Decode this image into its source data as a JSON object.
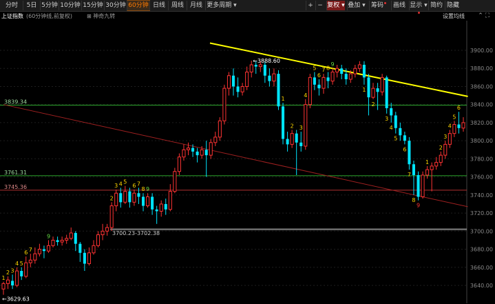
{
  "toolbar": {
    "periods": [
      "分时",
      "5日",
      "5分钟",
      "10分钟",
      "15分钟",
      "30分钟",
      "60分钟",
      "日线",
      "周线",
      "月线",
      "更多周期"
    ],
    "active_period": "60分钟",
    "right_buttons": [
      "+",
      "−",
      "复权",
      "叠加",
      "筹码",
      "画线",
      "显示",
      "简约",
      "隐藏"
    ]
  },
  "subbar": {
    "title": "上证指数",
    "description": "(60分钟线,前复权)",
    "nine_turn": "神奇九转",
    "ma_settings": "设置均线"
  },
  "chart_data": {
    "type": "candlestick",
    "title": "上证指数",
    "ylim": [
      3630,
      3910
    ],
    "y_ticks": [
      3640,
      3660,
      3680,
      3700,
      3720,
      3740,
      3760,
      3780,
      3800,
      3820,
      3840,
      3860,
      3880,
      3900
    ],
    "up_color": "#ff3333",
    "down_color": "#00e5ff",
    "candles": [
      [
        3636,
        3642,
        3629.63,
        3644
      ],
      [
        3642,
        3646,
        3636,
        3650
      ],
      [
        3645,
        3640,
        3636,
        3652
      ],
      [
        3640,
        3656,
        3638,
        3660
      ],
      [
        3656,
        3650,
        3646,
        3660
      ],
      [
        3650,
        3665,
        3648,
        3672
      ],
      [
        3665,
        3668,
        3660,
        3675
      ],
      [
        3668,
        3675,
        3664,
        3682
      ],
      [
        3675,
        3680,
        3672,
        3686
      ],
      [
        3680,
        3678,
        3670,
        3684
      ],
      [
        3678,
        3684,
        3676,
        3690
      ],
      [
        3684,
        3690,
        3682,
        3694
      ],
      [
        3690,
        3688,
        3684,
        3694
      ],
      [
        3688,
        3690,
        3684,
        3694
      ],
      [
        3690,
        3692,
        3686,
        3696
      ],
      [
        3692,
        3698,
        3690,
        3704
      ],
      [
        3698,
        3686,
        3678,
        3700
      ],
      [
        3686,
        3676,
        3666,
        3688
      ],
      [
        3676,
        3664,
        3656,
        3680
      ],
      [
        3664,
        3676,
        3662,
        3682
      ],
      [
        3676,
        3684,
        3674,
        3690
      ],
      [
        3684,
        3696,
        3682,
        3700
      ],
      [
        3696,
        3700,
        3690,
        3708
      ],
      [
        3700,
        3704,
        3695,
        3708
      ],
      [
        3704,
        3728,
        3700.23,
        3732
      ],
      [
        3728,
        3742,
        3722,
        3746
      ],
      [
        3742,
        3732,
        3726,
        3748
      ],
      [
        3732,
        3744,
        3730,
        3750
      ],
      [
        3744,
        3732,
        3726,
        3748
      ],
      [
        3732,
        3742,
        3728,
        3746
      ],
      [
        3742,
        3738,
        3730,
        3748
      ],
      [
        3738,
        3728,
        3722,
        3742
      ],
      [
        3728,
        3738,
        3726,
        3742
      ],
      [
        3738,
        3724,
        3718,
        3742
      ],
      [
        3724,
        3722,
        3708,
        3728
      ],
      [
        3722,
        3730,
        3716,
        3734
      ],
      [
        3730,
        3724,
        3718,
        3736
      ],
      [
        3724,
        3744,
        3722,
        3752
      ],
      [
        3744,
        3766,
        3742,
        3770
      ],
      [
        3766,
        3782,
        3762,
        3786
      ],
      [
        3782,
        3790,
        3778,
        3796
      ],
      [
        3790,
        3792,
        3784,
        3798
      ],
      [
        3792,
        3788,
        3782,
        3796
      ],
      [
        3788,
        3784,
        3776,
        3792
      ],
      [
        3784,
        3790,
        3780,
        3794
      ],
      [
        3790,
        3784,
        3760,
        3800
      ],
      [
        3784,
        3798,
        3780,
        3802
      ],
      [
        3798,
        3804,
        3794,
        3810
      ],
      [
        3804,
        3822,
        3800,
        3826
      ],
      [
        3822,
        3858,
        3818,
        3862
      ],
      [
        3858,
        3872,
        3850,
        3876
      ],
      [
        3872,
        3860,
        3850,
        3880
      ],
      [
        3860,
        3854,
        3848,
        3870
      ],
      [
        3854,
        3860,
        3850,
        3864
      ],
      [
        3860,
        3876,
        3856,
        3882
      ],
      [
        3876,
        3884,
        3870,
        3888.6
      ],
      [
        3884,
        3882,
        3874,
        3888
      ],
      [
        3882,
        3884,
        3876,
        3888
      ],
      [
        3884,
        3872,
        3864,
        3888
      ],
      [
        3872,
        3866,
        3860,
        3880
      ],
      [
        3866,
        3874,
        3860,
        3880
      ],
      [
        3874,
        3838,
        3834,
        3878
      ],
      [
        3838,
        3802,
        3796,
        3842
      ],
      [
        3802,
        3796,
        3788,
        3810
      ],
      [
        3796,
        3808,
        3792,
        3812
      ],
      [
        3808,
        3798,
        3762,
        3812
      ],
      [
        3798,
        3794,
        3788,
        3810
      ],
      [
        3794,
        3840,
        3790,
        3846
      ],
      [
        3840,
        3870,
        3836,
        3874
      ],
      [
        3870,
        3862,
        3856,
        3876
      ],
      [
        3862,
        3858,
        3850,
        3868
      ],
      [
        3858,
        3870,
        3852,
        3874
      ],
      [
        3870,
        3866,
        3858,
        3876
      ],
      [
        3866,
        3876,
        3862,
        3880
      ],
      [
        3876,
        3880,
        3870,
        3884
      ],
      [
        3880,
        3874,
        3868,
        3884
      ],
      [
        3874,
        3868,
        3862,
        3880
      ],
      [
        3868,
        3874,
        3864,
        3878
      ],
      [
        3874,
        3880,
        3870,
        3884
      ],
      [
        3880,
        3884,
        3876,
        3888
      ],
      [
        3884,
        3870,
        3862,
        3888
      ],
      [
        3870,
        3848,
        3828,
        3874
      ],
      [
        3848,
        3858,
        3846,
        3864
      ],
      [
        3858,
        3854,
        3834,
        3864
      ],
      [
        3854,
        3870,
        3850,
        3874
      ],
      [
        3870,
        3836,
        3830,
        3872
      ],
      [
        3836,
        3828,
        3820,
        3842
      ],
      [
        3828,
        3814,
        3808,
        3832
      ],
      [
        3814,
        3806,
        3800,
        3820
      ],
      [
        3806,
        3800,
        3796,
        3810
      ],
      [
        3800,
        3774,
        3768,
        3804
      ],
      [
        3774,
        3762,
        3740,
        3778
      ],
      [
        3762,
        3738,
        3734,
        3766
      ],
      [
        3738,
        3762,
        3736,
        3766
      ],
      [
        3762,
        3768,
        3758,
        3772
      ],
      [
        3768,
        3772,
        3744,
        3776
      ],
      [
        3772,
        3776,
        3768,
        3782
      ],
      [
        3776,
        3784,
        3772,
        3788
      ],
      [
        3784,
        3796,
        3780,
        3800
      ],
      [
        3796,
        3808,
        3792,
        3812
      ],
      [
        3808,
        3818,
        3804,
        3822
      ],
      [
        3818,
        3814,
        3808,
        3832
      ],
      [
        3814,
        3820,
        3810,
        3826
      ]
    ],
    "h_lines": [
      {
        "value": 3839.34,
        "label": "3839.34",
        "color": "#2ea82e"
      },
      {
        "value": 3761.31,
        "label": "3761.31",
        "color": "#2ea82e"
      },
      {
        "value": 3745.36,
        "label": "3745.36",
        "color": "#b03030"
      },
      {
        "value": 3702.38,
        "label": "3700.23-3702.38",
        "color": "#aaaaaa"
      }
    ],
    "annotations": [
      {
        "label": "3888.60",
        "value": 3888.6,
        "index": 55
      },
      {
        "label": "3629.63",
        "value": 3629.63,
        "index": 0
      }
    ],
    "nine_counts": [
      {
        "index": 0,
        "label": "1",
        "color": "#ffd700",
        "pos": "above"
      },
      {
        "index": 1,
        "label": "2",
        "color": "#ffd700",
        "pos": "above"
      },
      {
        "index": 2,
        "label": "3",
        "color": "#ffd700",
        "pos": "above"
      },
      {
        "index": 3,
        "label": "4",
        "color": "#ffd700",
        "pos": "above"
      },
      {
        "index": 4,
        "label": "5",
        "color": "#ffd700",
        "pos": "above"
      },
      {
        "index": 5,
        "label": "6",
        "color": "#ffd700",
        "pos": "above"
      },
      {
        "index": 6,
        "label": "7",
        "color": "#ffd700",
        "pos": "above"
      },
      {
        "index": 10,
        "label": "9",
        "color": "#66dd44",
        "pos": "above"
      },
      {
        "index": 24,
        "label": "2",
        "color": "#ffd700",
        "pos": "above"
      },
      {
        "index": 25,
        "label": "3",
        "color": "#ffd700",
        "pos": "above"
      },
      {
        "index": 26,
        "label": "4",
        "color": "#ffd700",
        "pos": "above"
      },
      {
        "index": 27,
        "label": "5",
        "color": "#ffd700",
        "pos": "above"
      },
      {
        "index": 29,
        "label": "6",
        "color": "#ffd700",
        "pos": "above"
      },
      {
        "index": 30,
        "label": "7",
        "color": "#ffd700",
        "pos": "above"
      },
      {
        "index": 31,
        "label": "8",
        "color": "#ffd700",
        "pos": "above"
      },
      {
        "index": 32,
        "label": "9",
        "color": "#66dd44",
        "pos": "above"
      },
      {
        "index": 62,
        "label": "1",
        "color": "#ffd700",
        "pos": "above"
      },
      {
        "index": 64,
        "label": "2",
        "color": "#ffd700",
        "pos": "above"
      },
      {
        "index": 66,
        "label": "3",
        "color": "#ffd700",
        "pos": "above"
      },
      {
        "index": 67,
        "label": "4",
        "color": "#ffd700",
        "pos": "above"
      },
      {
        "index": 69,
        "label": "5",
        "color": "#ffd700",
        "pos": "above"
      },
      {
        "index": 70,
        "label": "6",
        "color": "#ffd700",
        "pos": "above"
      },
      {
        "index": 71,
        "label": "7",
        "color": "#ffd700",
        "pos": "above"
      },
      {
        "index": 72,
        "label": "8",
        "color": "#ffd700",
        "pos": "above"
      },
      {
        "index": 73,
        "label": "9",
        "color": "#66dd44",
        "pos": "above"
      },
      {
        "index": 80,
        "label": "1",
        "color": "#ffd700",
        "pos": "below"
      },
      {
        "index": 82,
        "label": "2",
        "color": "#ffd700",
        "pos": "below"
      },
      {
        "index": 85,
        "label": "3",
        "color": "#ffd700",
        "pos": "below"
      },
      {
        "index": 86,
        "label": "4",
        "color": "#ffd700",
        "pos": "below"
      },
      {
        "index": 87,
        "label": "5",
        "color": "#ffd700",
        "pos": "below"
      },
      {
        "index": 89,
        "label": "6",
        "color": "#ffd700",
        "pos": "below"
      },
      {
        "index": 90,
        "label": "7",
        "color": "#ffd700",
        "pos": "below"
      },
      {
        "index": 91,
        "label": "8",
        "color": "#ffd700",
        "pos": "below"
      },
      {
        "index": 92,
        "label": "9",
        "color": "#ff3333",
        "pos": "below"
      },
      {
        "index": 94,
        "label": "1",
        "color": "#ffd700",
        "pos": "above"
      },
      {
        "index": 97,
        "label": "2",
        "color": "#ffd700",
        "pos": "above"
      },
      {
        "index": 98,
        "label": "3",
        "color": "#ffd700",
        "pos": "above"
      },
      {
        "index": 99,
        "label": "4",
        "color": "#ffd700",
        "pos": "above"
      },
      {
        "index": 100,
        "label": "5",
        "color": "#ffd700",
        "pos": "above"
      },
      {
        "index": 101,
        "label": "6",
        "color": "#ffd700",
        "pos": "above"
      }
    ],
    "trendlines": [
      {
        "color": "#ffff00",
        "start": {
          "index": 46,
          "value": 3908
        },
        "end": {
          "index": 103,
          "value": 3849
        }
      },
      {
        "color": "#a02020",
        "start": {
          "index": 0,
          "value": 3840
        },
        "end": {
          "index": 103,
          "value": 3727
        }
      }
    ]
  }
}
